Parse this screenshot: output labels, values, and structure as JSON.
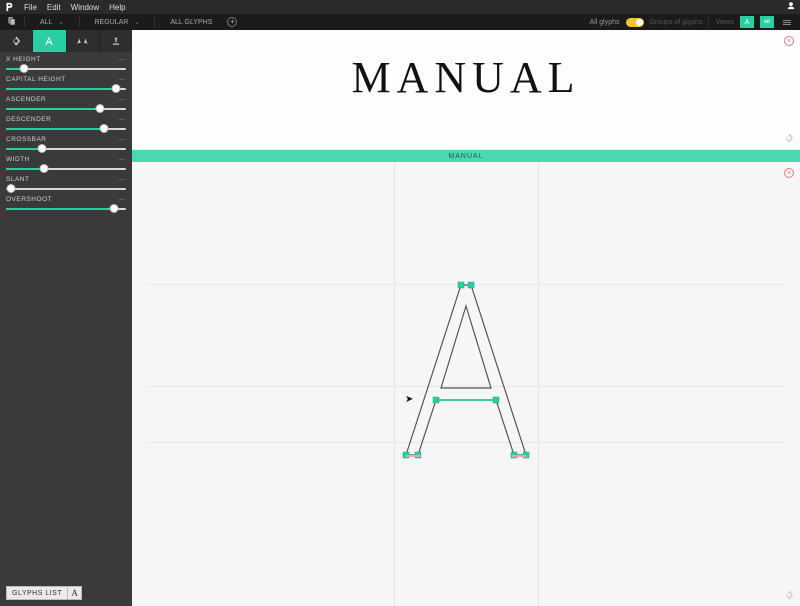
{
  "menu": {
    "items": [
      "File",
      "Edit",
      "Window",
      "Help"
    ]
  },
  "toolbar": {
    "font_select": "ALL",
    "weight_select": "REGULAR",
    "glyphs_select": "ALL GLYPHS",
    "right": {
      "all_glyphs": "All glyphs",
      "groups_of_glyphs": "Groups of glyphs",
      "views": "Views",
      "view_letter": "A"
    }
  },
  "sidebar": {
    "params": [
      {
        "label": "X HEIGHT",
        "pct": 15
      },
      {
        "label": "CAPITAL HEIGHT",
        "pct": 92
      },
      {
        "label": "ASCENDER",
        "pct": 78
      },
      {
        "label": "DESCENDER",
        "pct": 82
      },
      {
        "label": "CROSSBAR",
        "pct": 30
      },
      {
        "label": "WIDTH",
        "pct": 32
      },
      {
        "label": "SLANT",
        "pct": 4
      },
      {
        "label": "OVERSHOOT",
        "pct": 90
      }
    ],
    "glyphs_list": {
      "label": "GLYPHS LIST",
      "glyph": "A"
    }
  },
  "preview": {
    "text": "MANUAL",
    "banner": "MANUAL"
  },
  "editor": {
    "current_glyph": "A"
  }
}
